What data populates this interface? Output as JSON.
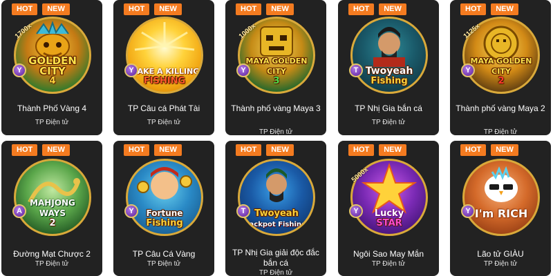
{
  "badges": {
    "hot": "HOT",
    "new": "NEW"
  },
  "provider": "TP Điện tử",
  "colors": {
    "card_bg": "#222222",
    "badge_bg": "#f47b20",
    "ring": "#d9a93a"
  },
  "games": [
    {
      "name": "Thành Phố Vàng 4",
      "art_title": "GOLDEN CITY",
      "art_sub": "4",
      "multiplier": "1700x",
      "tag": "Y"
    },
    {
      "name": "TP Câu cá Phát Tài",
      "art_title": "MAKE A KILLING",
      "art_sub": "FISHING",
      "multiplier": "",
      "tag": "Y"
    },
    {
      "name": "Thành phố vàng Maya 3",
      "art_title": "MAYA GOLDEN CITY",
      "art_sub": "3",
      "multiplier": "1000x",
      "tag": "Y"
    },
    {
      "name": "TP Nhị Gia bắn cá",
      "art_title": "Twoyeah",
      "art_sub": "Fishing",
      "multiplier": "",
      "tag": "T"
    },
    {
      "name": "Thành phố vàng Maya 2",
      "art_title": "MAYA GOLDEN CITY",
      "art_sub": "2",
      "multiplier": "1125x",
      "tag": "Y"
    },
    {
      "name": "Đường Mạt Chược 2",
      "art_title": "MAHJONG WAYS",
      "art_sub": "2",
      "multiplier": "",
      "tag": "A"
    },
    {
      "name": "TP Câu Cá Vàng",
      "art_title": "Fortune",
      "art_sub": "Fishing",
      "multiplier": "",
      "tag": "Y"
    },
    {
      "name": "TP Nhị Gia giải độc đắc bắn cá",
      "art_title": "Twoyeah",
      "art_sub": "Jackpot Fishing",
      "multiplier": "",
      "tag": "T"
    },
    {
      "name": "Ngôi Sao May Mắn",
      "art_title": "Lucky",
      "art_sub": "STAR",
      "multiplier": "5000x",
      "tag": "Y"
    },
    {
      "name": "Lão tử GIÀU",
      "art_title": "I'm RICH",
      "art_sub": "",
      "multiplier": "",
      "tag": "Y"
    }
  ]
}
